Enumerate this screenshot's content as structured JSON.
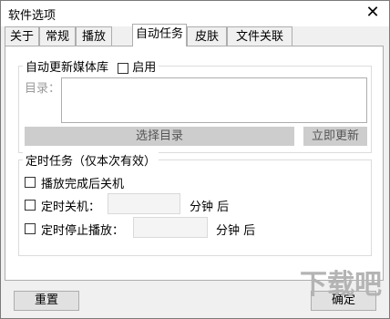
{
  "window": {
    "title": "软件选项",
    "close_icon": "close-icon"
  },
  "tabs": [
    "关于",
    "常规",
    "播放",
    "自动任务",
    "皮肤",
    "文件关联"
  ],
  "active_tab": "自动任务",
  "auto_update": {
    "legend": "自动更新媒体库",
    "enable_label": "启用",
    "enabled": false,
    "dir_label": "目录：",
    "dir_value": "",
    "select_dir_button": "选择目录",
    "update_now_button": "立即更新"
  },
  "scheduled": {
    "legend": "定时任务（仅本次有效）",
    "shutdown_after_play": "播放完成后关机",
    "timed_shutdown_label": "定时关机：",
    "timed_shutdown_value": "",
    "timed_shutdown_unit": "分钟 后",
    "timed_stop_label": "定时停止播放：",
    "timed_stop_value": "",
    "timed_stop_unit": "分钟 后"
  },
  "footer": {
    "reset_button": "重置",
    "ok_button": "确定"
  },
  "watermark": "下载吧"
}
